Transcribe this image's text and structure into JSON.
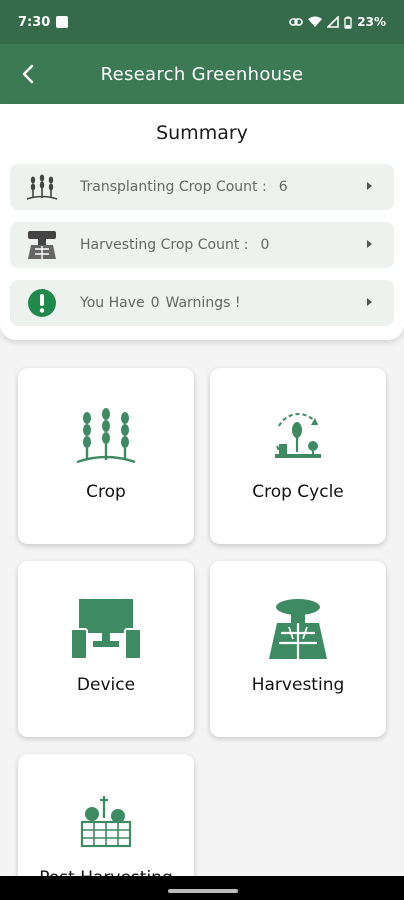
{
  "status_bar": {
    "time": "7:30",
    "battery": "23%"
  },
  "app_bar": {
    "title": "Research Greenhouse",
    "back_icon": "back-chevron-icon"
  },
  "summary": {
    "title": "Summary",
    "rows": [
      {
        "label": "Transplanting Crop Count :",
        "value": "6",
        "icon": "wheat-icon"
      },
      {
        "label": "Harvesting Crop Count :",
        "value": "0",
        "icon": "harvest-icon"
      },
      {
        "prefix": "You Have",
        "value": "0",
        "suffix": "Warnings !",
        "icon": "warning-icon"
      }
    ]
  },
  "menu": [
    {
      "label": "Crop",
      "icon": "crop-icon"
    },
    {
      "label": "Crop Cycle",
      "icon": "crop-cycle-icon"
    },
    {
      "label": "Device",
      "icon": "device-icon"
    },
    {
      "label": "Harvesting",
      "icon": "harvesting-icon"
    },
    {
      "label": "Post Harvesting",
      "icon": "post-harvesting-icon"
    }
  ],
  "colors": {
    "primary": "#3c7a56",
    "status": "#356b4b",
    "icon": "#3d8a63"
  }
}
